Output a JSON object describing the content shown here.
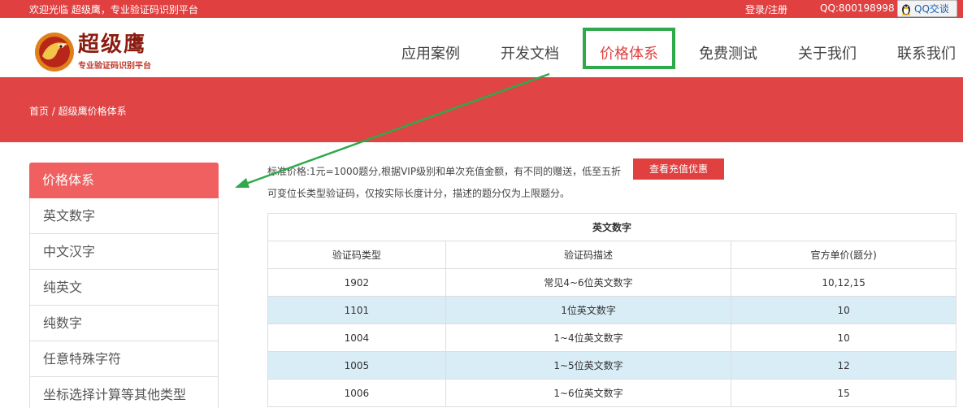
{
  "topbar": {
    "welcome": "欢迎光临 超级鹰，专业验证码识别平台",
    "login": "登录/注册",
    "qq_number": "QQ:800198998",
    "qq_chat": "QQ交谈"
  },
  "logo": {
    "name": "超级鹰",
    "slogan": "专业验证码识别平台"
  },
  "nav": [
    {
      "label": "应用案例"
    },
    {
      "label": "开发文档"
    },
    {
      "label": "价格体系"
    },
    {
      "label": "免费测试"
    },
    {
      "label": "关于我们"
    },
    {
      "label": "联系我们"
    }
  ],
  "breadcrumb": "首页 / 超级鹰价格体系",
  "sidebar": {
    "title": "价格体系",
    "items": [
      {
        "label": "英文数字"
      },
      {
        "label": "中文汉字"
      },
      {
        "label": "纯英文"
      },
      {
        "label": "纯数字"
      },
      {
        "label": "任意特殊字符"
      },
      {
        "label": "坐标选择计算等其他类型"
      }
    ]
  },
  "intro": {
    "line1": "标准价格:1元=1000题分,根据VIP级别和单次充值金额，有不同的赠送，低至五折",
    "line2": "可变位长类型验证码，仅按实际长度计分，描述的题分仅为上限题分。",
    "promo_button": "查看充值优惠"
  },
  "table": {
    "title": "英文数字",
    "headers": [
      "验证码类型",
      "验证码描述",
      "官方单价(题分)"
    ],
    "rows": [
      {
        "type": "1902",
        "desc": "常见4~6位英文数字",
        "price": "10,12,15"
      },
      {
        "type": "1101",
        "desc": "1位英文数字",
        "price": "10"
      },
      {
        "type": "1004",
        "desc": "1~4位英文数字",
        "price": "10"
      },
      {
        "type": "1005",
        "desc": "1~5位英文数字",
        "price": "12"
      },
      {
        "type": "1006",
        "desc": "1~6位英文数字",
        "price": "15"
      }
    ]
  },
  "colors": {
    "brand_red": "#e04040",
    "highlight_green": "#2eaa4a",
    "row_alt": "#d9edf7"
  }
}
